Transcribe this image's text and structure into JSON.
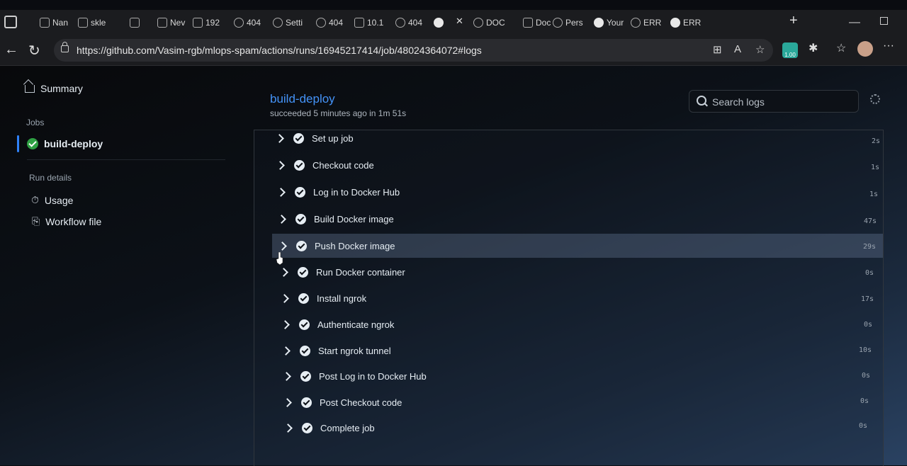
{
  "browser": {
    "tabs": [
      {
        "label": "Nan",
        "icon": "window-icon"
      },
      {
        "label": "skle",
        "icon": "page-icon"
      },
      {
        "label": "",
        "icon": "folder-icon"
      },
      {
        "label": "Nev",
        "icon": "page-icon"
      },
      {
        "label": "192",
        "icon": "page-icon"
      },
      {
        "label": "404",
        "icon": "globe-icon"
      },
      {
        "label": "Setti",
        "icon": "gear-icon"
      },
      {
        "label": "404",
        "icon": "globe-icon"
      },
      {
        "label": "10.1",
        "icon": "page-icon"
      },
      {
        "label": "404",
        "icon": "globe-icon"
      },
      {
        "label": "",
        "icon": "github-icon"
      },
      {
        "label": "DOC",
        "icon": "search-icon"
      },
      {
        "label": "Doc",
        "icon": "page-icon"
      },
      {
        "label": "Pers",
        "icon": "docker-icon"
      },
      {
        "label": "Your",
        "icon": "n-icon"
      },
      {
        "label": "ERR",
        "icon": "globe-icon"
      },
      {
        "label": "ERR",
        "icon": "n-icon"
      }
    ],
    "url": "https://github.com/Vasim-rgb/mlops-spam/actions/runs/16945217414/job/48024364072#logs",
    "extension_badge": "1.00"
  },
  "sidebar": {
    "summary_label": "Summary",
    "jobs_heading": "Jobs",
    "active_job": "build-deploy",
    "run_details_heading": "Run details",
    "usage_label": "Usage",
    "workflow_file_label": "Workflow file"
  },
  "job": {
    "title": "build-deploy",
    "subtitle": "succeeded 5 minutes ago in 1m 51s",
    "search_placeholder": "Search logs"
  },
  "steps": [
    {
      "name": "Set up job",
      "duration": "2s"
    },
    {
      "name": "Checkout code",
      "duration": "1s"
    },
    {
      "name": "Log in to Docker Hub",
      "duration": "1s"
    },
    {
      "name": "Build Docker image",
      "duration": "47s"
    },
    {
      "name": "Push Docker image",
      "duration": "29s",
      "highlighted": true
    },
    {
      "name": "Run Docker container",
      "duration": "0s"
    },
    {
      "name": "Install ngrok",
      "duration": "17s"
    },
    {
      "name": "Authenticate ngrok",
      "duration": "0s"
    },
    {
      "name": "Start ngrok tunnel",
      "duration": "10s"
    },
    {
      "name": "Post Log in to Docker Hub",
      "duration": "0s"
    },
    {
      "name": "Post Checkout code",
      "duration": "0s"
    },
    {
      "name": "Complete job",
      "duration": "0s"
    }
  ],
  "colors": {
    "link": "#4493f8",
    "success": "#2ea043",
    "active_indicator": "#2f81f7"
  }
}
